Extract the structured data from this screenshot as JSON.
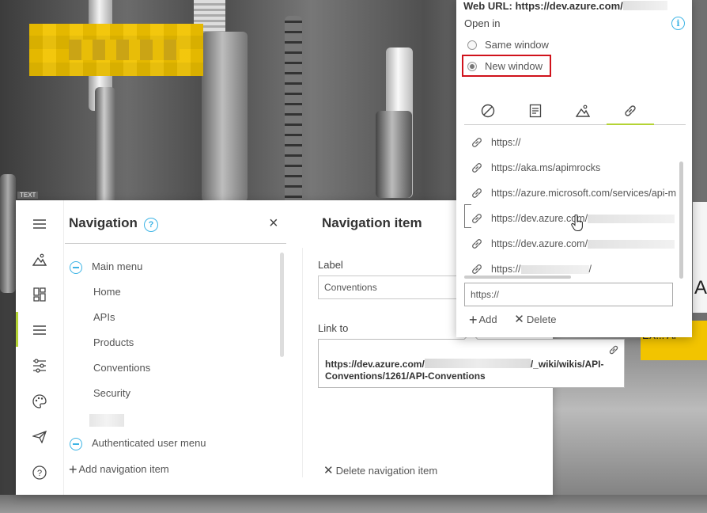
{
  "background": {
    "tag_text": "TEXT",
    "sign_text": "A",
    "banner_text": "EX... AP"
  },
  "sidebar_rail": {
    "items": [
      {
        "icon": "hamburger-menu-icon"
      },
      {
        "icon": "image-icon"
      },
      {
        "icon": "widgets-icon"
      },
      {
        "icon": "navigation-menu-icon",
        "active": true
      },
      {
        "icon": "settings-sliders-icon"
      },
      {
        "icon": "palette-icon"
      },
      {
        "icon": "send-icon"
      },
      {
        "icon": "help-icon"
      }
    ],
    "active_color": "#b4d334"
  },
  "navigation_panel": {
    "title": "Navigation",
    "help_glyph": "?",
    "close_glyph": "×",
    "tree": {
      "main_menu_label": "Main menu",
      "children": [
        "Home",
        "APIs",
        "Products",
        "Conventions",
        "Security"
      ],
      "authenticated_menu_label": "Authenticated user menu"
    },
    "add_button_label": "Add navigation item"
  },
  "item_panel": {
    "title": "Navigation item",
    "label_field_label": "Label",
    "label_value": "Conventions",
    "link_to_label": "Link to",
    "link_to_prefix": "https://dev.azure.com/",
    "link_to_suffix": "/_wiki/wikis/API-Conventions/1261/API-Conventions",
    "delete_button_label": "Delete navigation item"
  },
  "hyperlink_popup": {
    "web_url_label": "Web URL: https://dev.azure.com/",
    "open_in_label": "Open in",
    "info_glyph": "i",
    "options": [
      {
        "label": "Same window",
        "selected": false
      },
      {
        "label": "New window",
        "selected": true
      }
    ],
    "tabs": [
      {
        "icon": "none-icon"
      },
      {
        "icon": "document-icon"
      },
      {
        "icon": "image-icon"
      },
      {
        "icon": "link-icon",
        "active": true
      }
    ],
    "urls": [
      {
        "prefix": "https://",
        "suffix": ""
      },
      {
        "prefix": "https://aka.ms/apimrocks",
        "suffix": ""
      },
      {
        "prefix": "https://azure.microsoft.com/services/api-m",
        "suffix": ""
      },
      {
        "prefix": "https://dev.azure.com/",
        "suffix": ""
      },
      {
        "prefix": "https://dev.azure.com/",
        "suffix": ""
      },
      {
        "prefix": "https://",
        "suffix": "/"
      }
    ],
    "url_input_value": "https://",
    "add_label": "Add",
    "delete_label": "Delete",
    "highlight_color": "#d0121b",
    "accent_color": "#3db4e5"
  }
}
